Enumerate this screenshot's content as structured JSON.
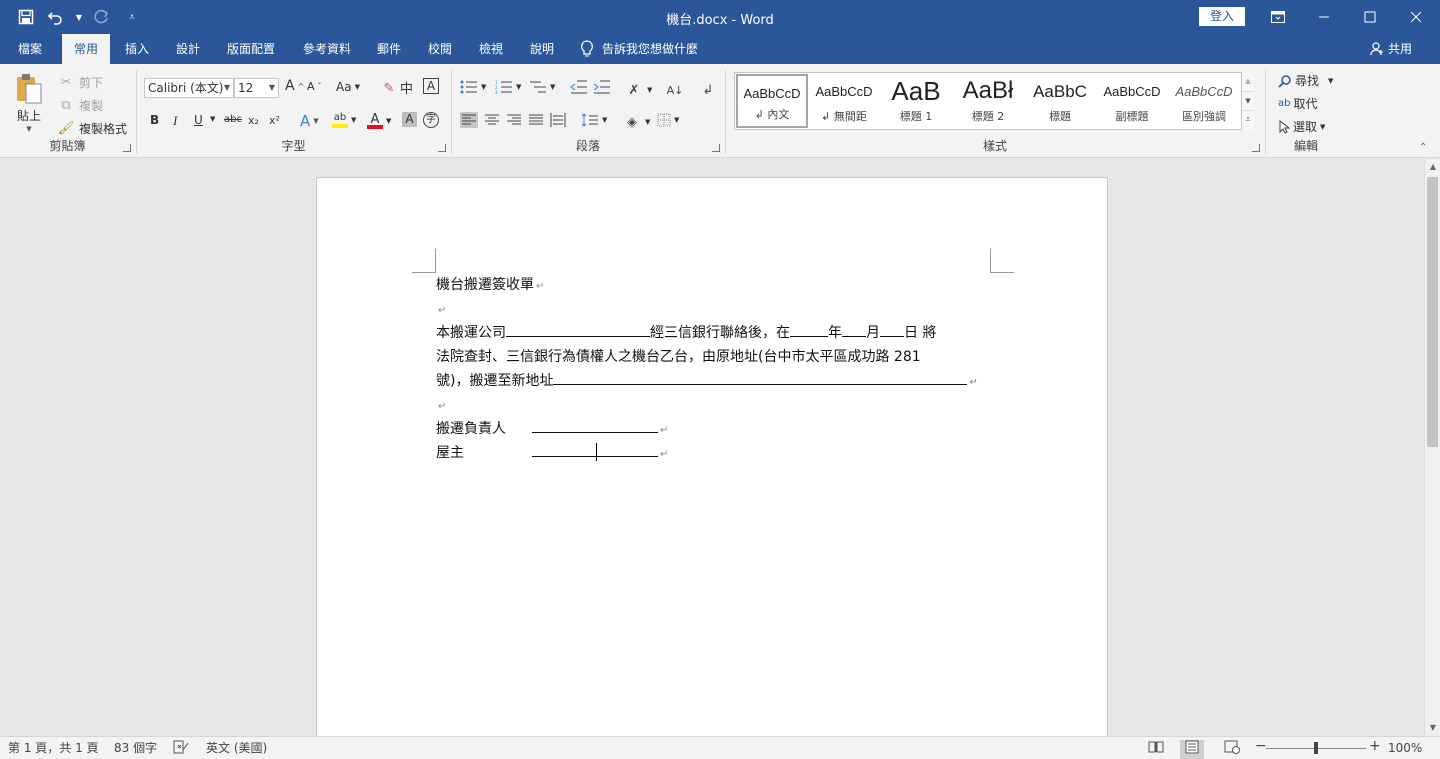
{
  "window": {
    "title": "機台.docx  -  Word",
    "login_label": "登入"
  },
  "quick_access": {
    "save_icon": "save-icon",
    "undo_icon": "undo-icon",
    "redo_icon": "redo-icon",
    "customize_icon": "customize-qat-icon"
  },
  "tabs": [
    {
      "label": "檔案"
    },
    {
      "label": "常用"
    },
    {
      "label": "插入"
    },
    {
      "label": "設計"
    },
    {
      "label": "版面配置"
    },
    {
      "label": "參考資料"
    },
    {
      "label": "郵件"
    },
    {
      "label": "校閱"
    },
    {
      "label": "檢視"
    },
    {
      "label": "說明"
    }
  ],
  "tell_me": "告訴我您想做什麼",
  "share_label": "共用",
  "ribbon": {
    "clipboard": {
      "label": "剪貼簿",
      "paste": "貼上",
      "cut": "剪下",
      "copy": "複製",
      "format_painter": "複製格式"
    },
    "font": {
      "label": "字型",
      "font_name": "Calibri (本文)",
      "font_size": "12",
      "change_case": "Aa",
      "bold": "B",
      "italic": "I",
      "underline": "U",
      "strike": "abc",
      "subscript": "x₂",
      "superscript": "x²"
    },
    "paragraph": {
      "label": "段落"
    },
    "styles": {
      "label": "樣式",
      "items": [
        {
          "sample": "AaBbCcD",
          "name": "↲ 內文"
        },
        {
          "sample": "AaBbCcD",
          "name": "↲ 無間距"
        },
        {
          "sample": "AaB",
          "name": "標題 1"
        },
        {
          "sample": "AaBł",
          "name": "標題 2"
        },
        {
          "sample": "AaBbC",
          "name": "標題"
        },
        {
          "sample": "AaBbCcD",
          "name": "副標題"
        },
        {
          "sample": "AaBbCcD",
          "name": "區別強調"
        }
      ]
    },
    "editing": {
      "label": "編輯",
      "find": "尋找",
      "replace": "取代",
      "select": "選取"
    }
  },
  "document": {
    "title": "機台搬遷簽收單",
    "para1_a": "本搬運公司",
    "para1_b": "經三信銀行聯絡後，在",
    "para1_c": "年",
    "para1_d": "月",
    "para1_e": "日  將",
    "para2": "法院查封、三信銀行為債權人之機台乙台，由原地址(台中市太平區成功路 281",
    "para3": "號)，搬遷至新地址",
    "sig1_label": "搬遷負責人",
    "sig2_label": "屋主",
    "paragraph_mark": "↵"
  },
  "status_bar": {
    "page": "第 1 頁，共 1 頁",
    "words": "83 個字",
    "language": "英文 (美國)",
    "zoom": "100%",
    "zoom_level": 1.0
  },
  "colors": {
    "accent": "#2b579a",
    "ribbon_bg": "#f3f3f3",
    "workspace_bg": "#e6e6e6"
  }
}
